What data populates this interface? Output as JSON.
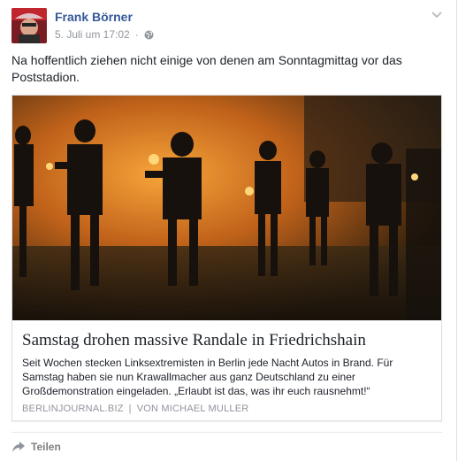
{
  "post": {
    "author": "Frank Börner",
    "timestamp": "5. Juli um 17:02",
    "separator": "·",
    "text": "Na hoffentlich ziehen nicht einige von denen am Sonntagmittag vor das Poststadion."
  },
  "link": {
    "title": "Samstag drohen massive Randale in Friedrichshain",
    "description": "Seit Wochen stecken Linksextremisten in Berlin jede Nacht Autos in Brand. Für Samstag haben sie nun Krawallmacher aus ganz Deutschland zu einer Großdemonstration eingeladen. „Erlaubt ist das, was ihr euch rausnehmt!“",
    "source_domain": "BERLINJOURNAL.BIZ",
    "source_separator": "|",
    "source_author": "VON MICHAEL MULLER"
  },
  "actions": {
    "share_label": "Teilen"
  },
  "icons": {
    "menu": "chevron-down-icon",
    "privacy": "globe-icon",
    "share": "share-arrow-icon"
  },
  "colors": {
    "author_link": "#365899",
    "meta_text": "#90949c",
    "body_text": "#1d2129",
    "share_text": "#7f7f7f"
  }
}
